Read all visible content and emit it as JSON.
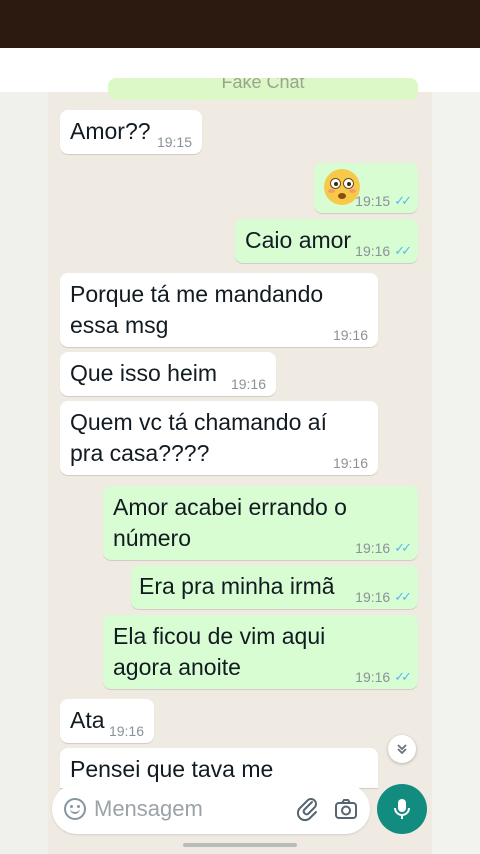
{
  "header": {
    "faded_title": "Fake Chat"
  },
  "messages": [
    {
      "dir": "in",
      "text": "Amor??",
      "time": "19:15"
    },
    {
      "dir": "out",
      "text": "",
      "emoji": "flushed-face",
      "time": "19:15",
      "read": true
    },
    {
      "dir": "out",
      "text": "Caio amor",
      "time": "19:16",
      "read": true
    },
    {
      "dir": "in",
      "text": "Porque tá me mandando essa msg",
      "time": "19:16"
    },
    {
      "dir": "in",
      "text": "Que isso heim",
      "time": "19:16"
    },
    {
      "dir": "in",
      "text": "Quem vc tá chamando aí pra casa????",
      "time": "19:16"
    },
    {
      "dir": "out",
      "text": "Amor acabei errando o número",
      "time": "19:16",
      "read": true
    },
    {
      "dir": "out",
      "text": "Era pra minha irmã",
      "time": "19:16",
      "read": true
    },
    {
      "dir": "out",
      "text": "Ela ficou de vim aqui agora anoite",
      "time": "19:16",
      "read": true
    },
    {
      "dir": "in",
      "text": "Ata",
      "time": "19:16"
    },
    {
      "dir": "in",
      "text": "Pensei que tava me",
      "time": ""
    }
  ],
  "composer": {
    "placeholder": "Mensagem"
  },
  "icons": {
    "scroll_down": "chevron-double-down-icon",
    "emoji": "smiley-icon",
    "attach": "paperclip-icon",
    "camera": "camera-icon",
    "mic": "microphone-icon"
  },
  "colors": {
    "incoming_bubble": "#ffffff",
    "outgoing_bubble": "#d9fdd3",
    "read_ticks": "#53bdeb",
    "mic_button": "#128c7e",
    "status_bar": "#2c1a10"
  }
}
